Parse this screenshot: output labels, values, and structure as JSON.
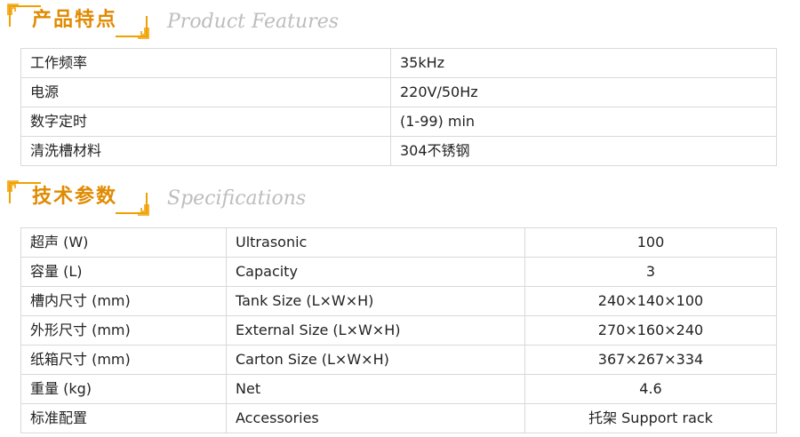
{
  "product_features": {
    "title_cn": "产品特点",
    "title_en": "Product Features",
    "rows": [
      {
        "label": "工作频率",
        "value": "35kHz"
      },
      {
        "label": "电源",
        "value": "220V/50Hz"
      },
      {
        "label": "数字定时",
        "value": "(1-99) min"
      },
      {
        "label": "清洗槽材料",
        "value": "304不锈钢"
      }
    ]
  },
  "specifications": {
    "title_cn": "技术参数",
    "title_en": "Specifications",
    "rows": [
      {
        "cn": "超声 (W)",
        "en": "Ultrasonic",
        "value": "100"
      },
      {
        "cn": "容量 (L)",
        "en": "Capacity",
        "value": "3"
      },
      {
        "cn": "槽内尺寸 (mm)",
        "en": "Tank Size (L×W×H)",
        "value": "240×140×100"
      },
      {
        "cn": "外形尺寸 (mm)",
        "en": "External Size (L×W×H)",
        "value": "270×160×240"
      },
      {
        "cn": "纸箱尺寸 (mm)",
        "en": "Carton Size (L×W×H)",
        "value": "367×267×334"
      },
      {
        "cn": "重量 (kg)",
        "en": "Net",
        "value": "4.6"
      },
      {
        "cn": "标准配置",
        "en": "Accessories",
        "value": "托架 Support rack"
      }
    ]
  },
  "colors": {
    "accent": "#e08a00",
    "bracket": "#f0a000",
    "subtitle": "#bdbdbd",
    "border": "#d9d9d9"
  }
}
